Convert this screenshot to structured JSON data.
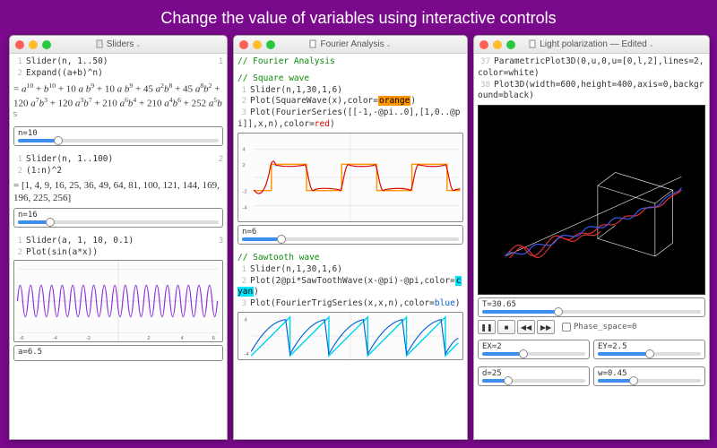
{
  "banner": "Change the value of variables using interactive controls",
  "windows": {
    "w1": {
      "title": "Sliders",
      "cell1": {
        "num": "1",
        "code1": "Slider(n, 1..50)",
        "code2": "Expand((a+b)^n)",
        "result": "= a¹⁰ + b¹⁰ + 10 a b⁹ + 10 a b⁹ + 45 a²b⁸ + 45 a⁸b² + 120 a⁷b³ + 120 a³b⁷ + 210 a⁶b⁴ + 210 a⁴b⁶ + 252 a⁵b⁵",
        "slider": "n=10"
      },
      "cell2": {
        "num": "2",
        "code1": "Slider(n, 1..100)",
        "code2": "(1:n)^2",
        "result": "= [1, 4, 9, 16, 25, 36, 49, 64, 81, 100, 121, 144, 169, 196, 225, 256]",
        "slider": "n=16"
      },
      "cell3": {
        "num": "3",
        "code1": "Slider(a, 1, 10, 0.1)",
        "code2": "Plot(sin(a*x))",
        "slider": "a=6.5"
      }
    },
    "w2": {
      "title": "Fourier Analysis",
      "head": "// Fourier Analysis",
      "sq": {
        "head": "// Square wave",
        "c1": "Slider(n,1,30,1,6)",
        "c2a": "Plot(SquareWave(x),color=",
        "c2b": ")",
        "c3a": "Plot(FourierSeries([[-1,-@pi..0],[1,0..@pi]],x,n),color=",
        "c3b": ")",
        "orange": "orange",
        "red": "red",
        "slider": "n=6"
      },
      "saw": {
        "head": "// Sawtooth wave",
        "c1": "Slider(n,1,30,1,6)",
        "c2a": "Plot(2@pi*SawToothWave(x-@pi)-@pi,color=",
        "c2b": ")",
        "c3a": "Plot(FourierTrigSeries(x,x,n),color=",
        "c3b": ")",
        "cyan": "cyan",
        "blue": "blue"
      }
    },
    "w3": {
      "title": "Light polarization — Edited",
      "code37": "ParametricPlot3D(0,u,0,u=[0,l,2],lines=2,color=white)",
      "code38": "Plot3D(width=600,height=400,axis=0,background=black)",
      "tlabel": "T=30.65",
      "phase": "Phase_space=0",
      "p": {
        "ex": "EX=2",
        "ey": "EY=2.5",
        "d": "d=25",
        "w": "w=0.45"
      }
    }
  },
  "chart_data": [
    {
      "type": "line",
      "title": "sin(a*x)",
      "xlim": [
        -6,
        6
      ],
      "ylim": [
        -1,
        1
      ],
      "note": "sine wave with frequency parameter a≈6.5, ~12 periods visible, color purple"
    },
    {
      "type": "line",
      "title": "Square wave + Fourier approximation",
      "xlim": [
        -6,
        6
      ],
      "ylim": [
        -4,
        4
      ],
      "series": [
        {
          "name": "SquareWave(x)",
          "color": "orange",
          "shape": "square wave amplitude ±1 period ~π"
        },
        {
          "name": "FourierSeries n=6",
          "color": "red",
          "shape": "Gibbs-ringing approximation to square wave"
        }
      ]
    },
    {
      "type": "line",
      "title": "Sawtooth wave + Fourier trig series",
      "xlim": [
        -6,
        6
      ],
      "ylim": [
        -4,
        4
      ],
      "series": [
        {
          "name": "SawToothWave",
          "color": "cyan",
          "shape": "linear ramp period 2π"
        },
        {
          "name": "FourierTrigSeries n=6",
          "color": "blue",
          "shape": "wobbly approximation to sawtooth"
        }
      ]
    },
    {
      "type": "3d-parametric",
      "title": "Light polarization",
      "background": "black",
      "elements": [
        "red helical wave",
        "blue helical wave",
        "white wireframe cube/plane"
      ]
    }
  ]
}
